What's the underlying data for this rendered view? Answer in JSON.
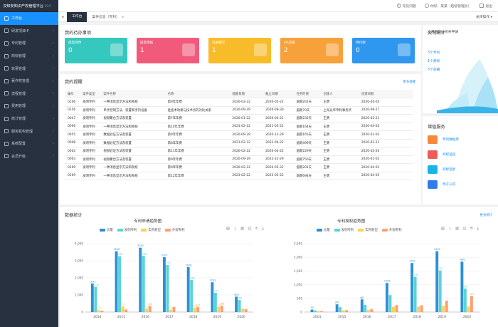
{
  "app": {
    "title": "汉知安知识产权管理平台",
    "version": "V3.5"
  },
  "sidebar": {
    "items": [
      {
        "label": "工作台",
        "active": true
      },
      {
        "label": "研发项目IP"
      },
      {
        "label": "专利管理"
      },
      {
        "label": "商标管理"
      },
      {
        "label": "软著管理"
      },
      {
        "label": "著作权管理"
      },
      {
        "label": "流程管理"
      },
      {
        "label": "费用管理"
      },
      {
        "label": "统计管理"
      },
      {
        "label": "服务机构管理"
      },
      {
        "label": "系统配置"
      },
      {
        "label": "会员升级"
      }
    ]
  },
  "topbar": {
    "faq": "常见问题",
    "user": "你好，某某（超级管理员）",
    "exit": "退出"
  },
  "tabs": {
    "items": [
      "工作台",
      "案件信息（专利）"
    ],
    "close_label": "关闭操作"
  },
  "todo": {
    "title": "我的待办事项",
    "cards": [
      {
        "label": "提案待改",
        "value": "0",
        "color": "#35c8bf"
      },
      {
        "label": "提案审核",
        "value": "1",
        "color": "#f25a7b"
      },
      {
        "label": "沟通撰写",
        "value": "1",
        "color": "#f8bc2a"
      },
      {
        "label": "OA答复",
        "value": "2",
        "color": "#f7a13a"
      },
      {
        "label": "待付款",
        "value": "0",
        "color": "#2f97ee"
      }
    ]
  },
  "reminder": {
    "title": "我的提醒",
    "more": "更多提醒",
    "columns": [
      "编号",
      "案件类型",
      "案件名称",
      "名称",
      "提醒日期",
      "截止日期",
      "任务时限",
      "创建人",
      "创建日期"
    ],
    "rows": [
      [
        "0106",
        "发明专利",
        "一种消息显示方法和系统",
        "第9年年费",
        "2020-02-22",
        "2020-05-22",
        "逾期201天",
        "王勇",
        "2020-04-03"
      ],
      [
        "0156",
        "发明专利",
        "单手控制方法、装置和手持设备",
        "挂挂术效果与技术点的对比关系",
        "2020-09-29",
        "2020-09-30",
        "逾期70天",
        "上海光华专利事务所",
        "2020-09-27"
      ],
      [
        "0047",
        "发明专利",
        "视频聚合方法及装置",
        "第7年年费",
        "2020-01-22",
        "2020-04-21",
        "逾期232天",
        "王勇",
        "2020-02-21"
      ],
      [
        "0006",
        "发明专利",
        "一种消息显示方法和系统",
        "第10年年费",
        "2021-02-22",
        "2021-05-22",
        "逾期164天",
        "王勇",
        "2020-04-03"
      ],
      [
        "0055",
        "发明专利",
        "数据验证方法及装置",
        "第9年年费",
        "2020-09-29",
        "2020-12-29",
        "逾期165天",
        "王勇",
        "2020-01-03"
      ],
      [
        "0008",
        "发明专利",
        "数据验证方法及装置",
        "第8年年费",
        "2021-02-22",
        "2022-04-22",
        "逾期499天",
        "王勇",
        "2020-02-21"
      ],
      [
        "0002",
        "发明专利",
        "视频验证方法及装置",
        "第11年年费",
        "2020-02-22",
        "2020-04-22",
        "逾期229天",
        "王勇",
        "2020-02-20"
      ],
      [
        "0003",
        "发明专利",
        "视频聚合方法及装置",
        "第9年年费",
        "2020-09-29",
        "2022-12-29",
        "逾期750天",
        "王勇",
        "2020-01-03"
      ],
      [
        "0109",
        "发明专利",
        "一种消息显示方法和系统",
        "第9年年费",
        "2020-02-22",
        "2020-05-22",
        "逾期201天",
        "王勇",
        "2020-04-03"
      ],
      [
        "0109",
        "发明专利",
        "一种消息显示方法和系统",
        "第12年年费",
        "2023-02-22",
        "2023-05-22",
        "逾期694天",
        "王勇",
        "2020-04-03"
      ]
    ]
  },
  "stats": {
    "title": "公司统计",
    "caption": "本月您的公司共申请",
    "links": [
      "3个专利",
      "1个商标",
      "3个软著"
    ]
  },
  "services": {
    "title": "增值服务",
    "items": [
      {
        "label": "专利数据库",
        "color": "#f5883a"
      },
      {
        "label": "商标监控",
        "color": "#ef5a5a"
      },
      {
        "label": "商标检索",
        "color": "#18b4e8"
      },
      {
        "label": "母子公司",
        "color": "#2f7ee8"
      }
    ]
  },
  "data_stats": {
    "title": "数据统计",
    "more": "更多统计"
  },
  "colors": {
    "total": "#2f8fd5",
    "invention": "#5ad3d8",
    "utility": "#ffd052",
    "design": "#ff9d72"
  },
  "chart_data": [
    {
      "type": "bar",
      "title": "专利申请趋势图",
      "categories": [
        "2014",
        "2015",
        "2016",
        "2017",
        "2018",
        "2019",
        "2020"
      ],
      "ylim": [
        0,
        4000
      ],
      "yticks": [
        "0",
        "1,000",
        "2,000",
        "3,000",
        "4,000"
      ],
      "series": [
        {
          "name": "总量",
          "values": [
            1673,
            3556,
            3762,
            3207,
            2628,
            1743,
            900
          ]
        },
        {
          "name": "发明专利",
          "values": [
            1474,
            3262,
            3288,
            2751,
            1882,
            1124,
            706
          ]
        },
        {
          "name": "实用新型",
          "values": [
            119,
            330,
            200,
            140,
            255,
            300,
            200
          ]
        },
        {
          "name": "外观专利",
          "values": [
            80,
            150,
            350,
            300,
            301,
            368,
            170
          ]
        }
      ],
      "labels": [
        [
          "1673",
          "3556",
          "3762",
          "3207",
          "2628",
          "1743",
          "900"
        ],
        [
          "1474",
          "3262",
          "3288",
          "2751",
          "1882",
          "1124",
          "706"
        ],
        [
          "119",
          "330",
          "200",
          "140",
          "255",
          "300",
          ""
        ],
        [
          "",
          "",
          "350",
          "",
          "301",
          "368",
          ""
        ]
      ]
    },
    {
      "type": "bar",
      "title": "专利授权趋势图",
      "categories": [
        "2014",
        "2015",
        "2016",
        "2017",
        "2018",
        "2019",
        "2020"
      ],
      "ylim": [
        0,
        2500
      ],
      "yticks": [
        "0",
        "500",
        "1,000",
        "1,500",
        "2,000",
        "2,500"
      ],
      "series": [
        {
          "name": "总量",
          "values": [
            90,
            282,
            462,
            1063,
            1792,
            2223,
            1843
          ]
        },
        {
          "name": "发明专利",
          "values": [
            60,
            180,
            260,
            620,
            1290,
            1521,
            860
          ]
        },
        {
          "name": "实用新型",
          "values": [
            40,
            60,
            80,
            190,
            200,
            230,
            200
          ]
        },
        {
          "name": "外观专利",
          "values": [
            30,
            70,
            102,
            253,
            247,
            415,
            585
          ]
        }
      ],
      "labels": [
        [
          "90",
          "282",
          "462",
          "1063",
          "1792",
          "2223",
          "1843"
        ],
        [
          "",
          "",
          "",
          "",
          "1290",
          "1521",
          "860"
        ],
        [
          "",
          "",
          "",
          "",
          "",
          "",
          ""
        ],
        [
          "",
          "",
          "",
          "",
          "",
          "",
          "585"
        ]
      ]
    }
  ]
}
